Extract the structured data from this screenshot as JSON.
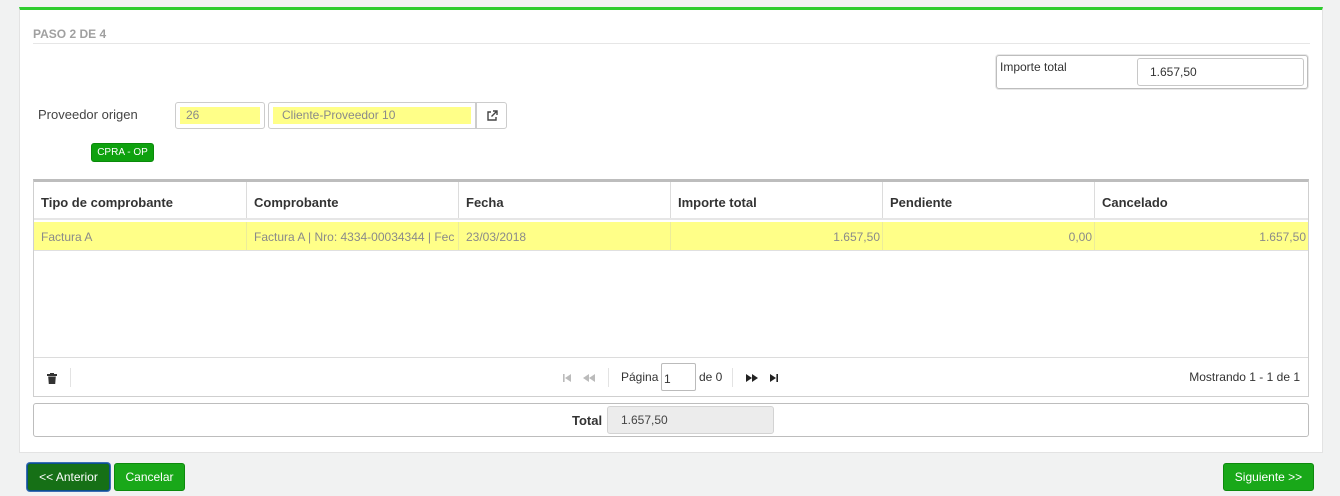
{
  "step": {
    "title": "PASO 2 DE 4"
  },
  "importe_total": {
    "label": "Importe total",
    "value": "1.657,50"
  },
  "proveedor": {
    "label": "Proveedor origen",
    "code": "26",
    "name": "Cliente-Proveedor 10"
  },
  "tag": {
    "label": "CPRA - OP"
  },
  "grid": {
    "columns": [
      "Tipo de comprobante",
      "Comprobante",
      "Fecha",
      "Importe total",
      "Pendiente",
      "Cancelado"
    ],
    "rows": [
      {
        "tipo": "Factura A",
        "comprobante": "Factura A | Nro: 4334-00034344 | Fec",
        "fecha": "23/03/2018",
        "importe": "1.657,50",
        "pendiente": "0,00",
        "cancelado": "1.657,50"
      }
    ]
  },
  "pager": {
    "page_label": "Página",
    "page_value": "1",
    "of_label": "de 0",
    "info": "Mostrando 1 - 1 de 1"
  },
  "footer": {
    "total_label": "Total",
    "total_value": "1.657,50"
  },
  "buttons": {
    "prev": "<< Anterior",
    "cancel": "Cancelar",
    "next": "Siguiente >>"
  },
  "colors": {
    "accent": "#2ecc2e",
    "button_green": "#19a819",
    "highlight": "#ffff88"
  },
  "icons": {
    "external_link": "external-link-icon",
    "trash": "trash-icon",
    "first": "first-page-icon",
    "prev": "prev-page-icon",
    "next": "next-page-icon",
    "last": "last-page-icon"
  }
}
